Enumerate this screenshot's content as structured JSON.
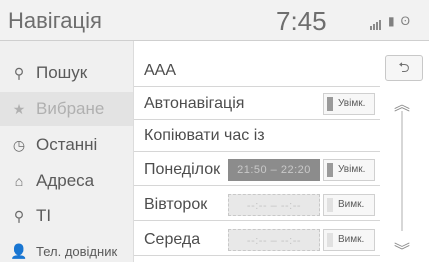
{
  "header": {
    "title": "Навігація",
    "time": "7:45",
    "status_icons": [
      "signal-bars-icon",
      "battery-icon",
      "bluetooth-icon"
    ]
  },
  "sidebar": {
    "items": [
      {
        "label": "Пошук",
        "icon": "search-icon",
        "glyph": "⚲"
      },
      {
        "label": "Вибране",
        "icon": "star-icon",
        "glyph": "★",
        "selected": true
      },
      {
        "label": "Останні",
        "icon": "clock-icon",
        "glyph": "◷"
      },
      {
        "label": "Адреса",
        "icon": "address-icon",
        "glyph": "⌂"
      },
      {
        "label": "ТІ",
        "icon": "poi-pin-icon",
        "glyph": "⚲"
      },
      {
        "label": "Тел. довідник",
        "icon": "person-icon",
        "glyph": "👤"
      }
    ]
  },
  "main": {
    "name_value": "AAA",
    "autonav_label": "Автонавігація",
    "autonav_state": "Увімк.",
    "copy_time_label": "Копіювати час із",
    "days": [
      {
        "label": "Понеділок",
        "time": "21:50 – 22:20",
        "state": "Увімк.",
        "on": true
      },
      {
        "label": "Вівторок",
        "time": "--:-- – --:--",
        "state": "Вимк.",
        "on": false
      },
      {
        "label": "Середа",
        "time": "--:-- – --:--",
        "state": "Вимк.",
        "on": false
      }
    ]
  },
  "controls": {
    "back": "⮌",
    "scroll_up": "︽",
    "scroll_down": "︾"
  },
  "colors": {
    "header_bg": "#f2f2f2",
    "sidebar_bg": "#f0f0f0",
    "active_time_bg": "#8c8c8c",
    "toggle_on_indicator": "#9a9a9a"
  }
}
